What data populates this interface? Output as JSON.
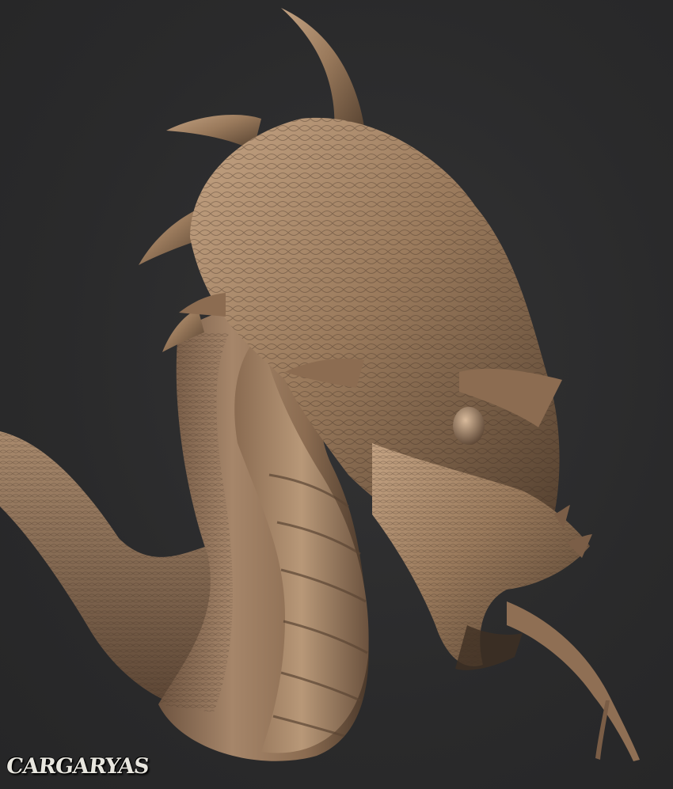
{
  "artwork": {
    "subject": "sculpted-serpent-dragon",
    "background_color": "#2b2b2c",
    "clay_color": "#9a7a5c",
    "clay_highlight": "#c9a98a",
    "clay_shadow": "#4d3a2b"
  },
  "signature": {
    "text": "CARGARYAS"
  }
}
